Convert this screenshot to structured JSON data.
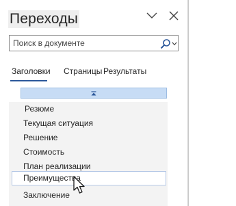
{
  "nav_pane": {
    "title": "Переходы",
    "chevron_icon": "chevron-down-icon",
    "close_icon": "close-icon"
  },
  "search": {
    "placeholder": "Поиск в документе",
    "value": "",
    "icon": "search-icon",
    "dropdown_icon": "caret-down-icon"
  },
  "tabs": [
    {
      "label": "Заголовки",
      "active": true
    },
    {
      "label": "Страницы",
      "active": false
    },
    {
      "label": "Результаты",
      "active": false
    }
  ],
  "collapse_bar": {
    "icon": "collapse-all-icon",
    "color": "#c7dcf5"
  },
  "headings": [
    {
      "label": "Резюме"
    },
    {
      "label": "Текущая ситуация"
    },
    {
      "label": "Решение"
    },
    {
      "label": "Стоимость"
    },
    {
      "label": "План реализации"
    },
    {
      "label": "Преимущества",
      "hovered": true
    },
    {
      "label": "Заключение"
    }
  ],
  "colors": {
    "accent": "#2b579a",
    "selection": "#c7dcf5",
    "list_background": "#f3f3f3",
    "workspace": "#e6e6e6"
  }
}
